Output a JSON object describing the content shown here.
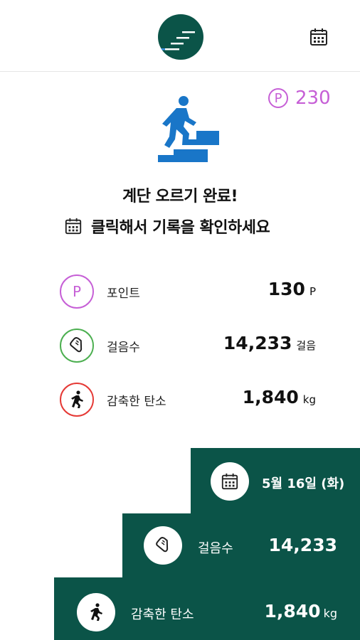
{
  "header": {
    "logo_icon": "stairs-logo-icon",
    "calendar_icon": "calendar-icon"
  },
  "points_badge": {
    "symbol": "P",
    "value": "230"
  },
  "hero_icon": "person-climbing-stairs-icon",
  "message": {
    "line1": "계단 오르기 완료!",
    "line2": "클릭해서 기록을 확인하세요"
  },
  "stats": [
    {
      "icon": "point-icon",
      "symbol": "P",
      "label": "포인트",
      "value": "130",
      "unit": "P",
      "color": "#c65fd6"
    },
    {
      "icon": "shoe-icon",
      "label": "걸음수",
      "value": "14,233",
      "unit": "걸음",
      "color": "#4caf50"
    },
    {
      "icon": "walking-person-icon",
      "label": "감축한 탄소",
      "value": "1,840",
      "unit": "kg",
      "color": "#e53935"
    }
  ],
  "stairs": {
    "date": "5월 16일 (화)",
    "steps_label": "걸음수",
    "steps_value": "14,233",
    "carbon_label": "감축한 탄소",
    "carbon_value": "1,840",
    "carbon_unit": "kg"
  },
  "colors": {
    "primary": "#0b5448",
    "accent_blue": "#1976c8",
    "points": "#c65fd6",
    "steps": "#4caf50",
    "carbon": "#e53935"
  }
}
